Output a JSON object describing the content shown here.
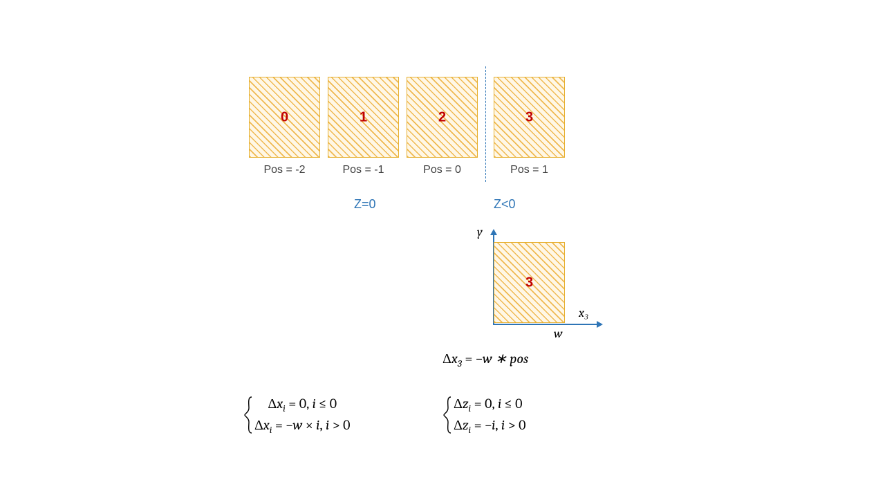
{
  "row": {
    "boxes": [
      {
        "label": "0",
        "caption": "Pos = -2"
      },
      {
        "label": "1",
        "caption": "Pos = -1"
      },
      {
        "label": "2",
        "caption": "Pos = 0"
      },
      {
        "label": "3",
        "caption": "Pos = 1"
      }
    ]
  },
  "zleft": "Z=0",
  "zright": "Z<0",
  "axes": {
    "y": "y",
    "x": "x₃",
    "w": "w",
    "box_label": "3"
  },
  "delta_eq": "Δx₃ = −w ∗ pos",
  "system_x": {
    "r1": "Δxᵢ = 0, i ≤ 0",
    "r2": "Δxᵢ = −w × i, i > 0"
  },
  "system_z": {
    "r1": "Δzᵢ = 0, i ≤ 0",
    "r2": "Δzᵢ = −i, i > 0"
  }
}
